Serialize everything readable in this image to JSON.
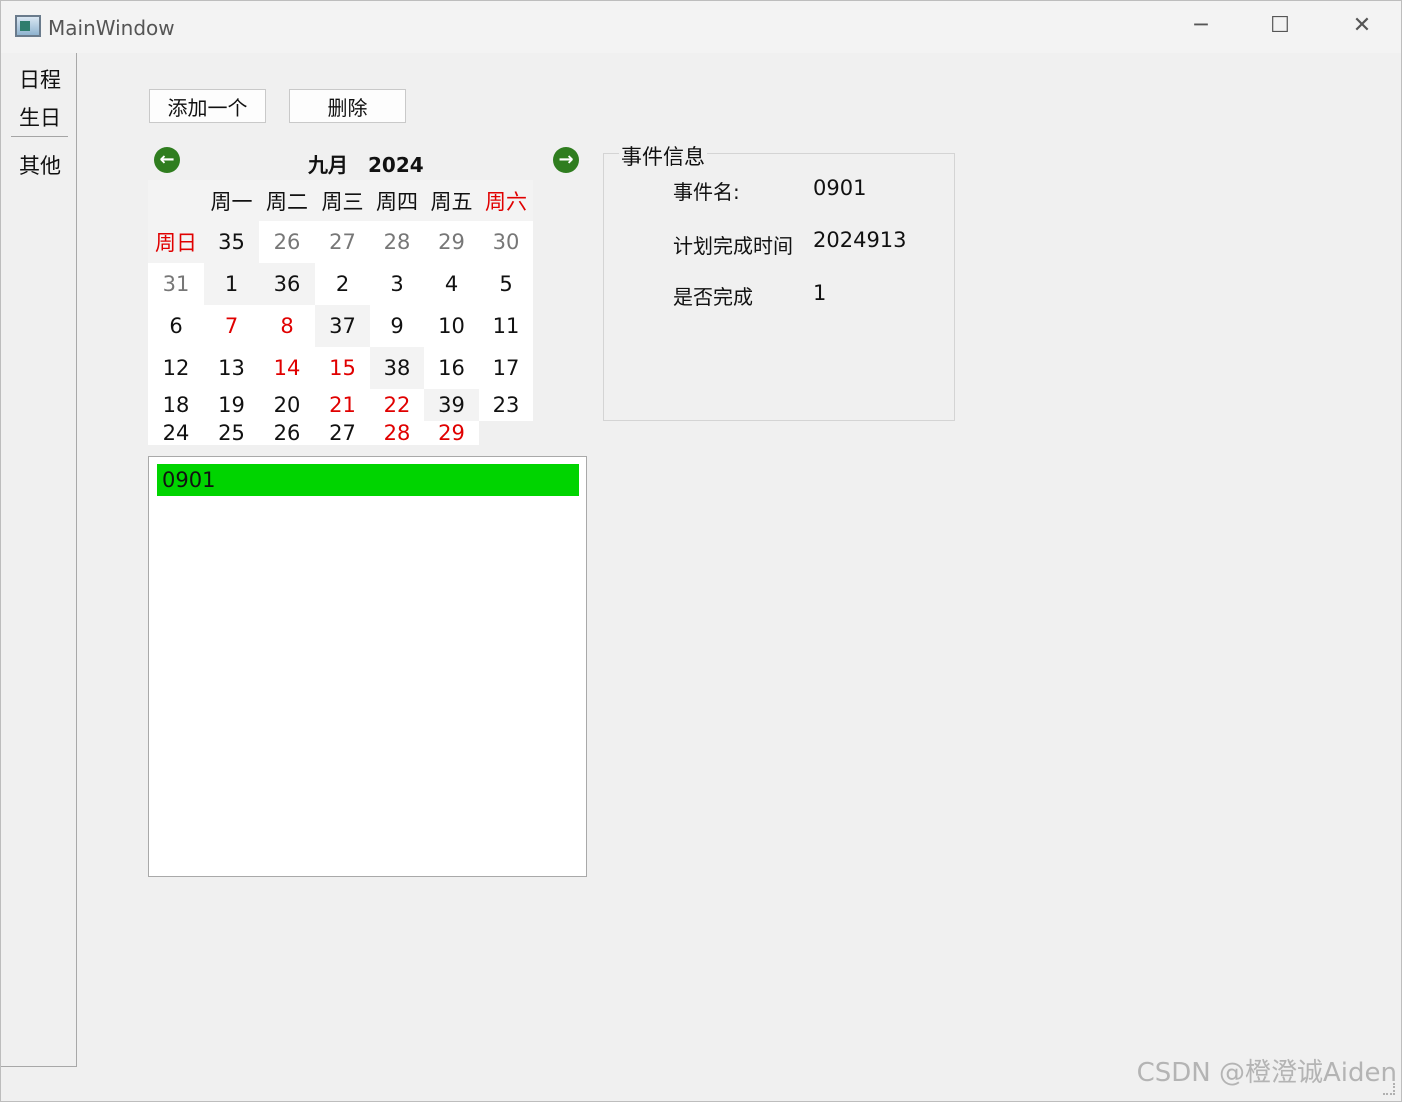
{
  "window": {
    "title": "MainWindow"
  },
  "sidebar": {
    "items": [
      "日程",
      "生日",
      "其他"
    ]
  },
  "toolbar": {
    "add_label": "添加一个",
    "delete_label": "删除"
  },
  "calendar": {
    "month": "九月",
    "year": "2024",
    "weekdays": [
      "周一",
      "周二",
      "周三",
      "周四",
      "周五",
      "周六",
      "周日"
    ],
    "weeks": [
      {
        "num": "35",
        "days": [
          "26",
          "27",
          "28",
          "29",
          "30",
          "31",
          "1"
        ]
      },
      {
        "num": "36",
        "days": [
          "2",
          "3",
          "4",
          "5",
          "6",
          "7",
          "8"
        ]
      },
      {
        "num": "37",
        "days": [
          "9",
          "10",
          "11",
          "12",
          "13",
          "14",
          "15"
        ]
      },
      {
        "num": "38",
        "days": [
          "16",
          "17",
          "18",
          "19",
          "20",
          "21",
          "22"
        ]
      },
      {
        "num": "39",
        "days": [
          "23",
          "24",
          "25",
          "26",
          "27",
          "28",
          "29"
        ]
      }
    ]
  },
  "event_info": {
    "title": "事件信息",
    "name_label": "事件名:",
    "name_value": "0901",
    "time_label": "计划完成时间",
    "time_value": "2024913",
    "done_label": "是否完成",
    "done_value": "1"
  },
  "event_list": {
    "items": [
      "0901"
    ]
  },
  "watermark": "CSDN @橙澄诚Aiden",
  "colors": {
    "highlight": "#00d400",
    "weekend": "#e00000",
    "nav": "#2f7d1f"
  }
}
